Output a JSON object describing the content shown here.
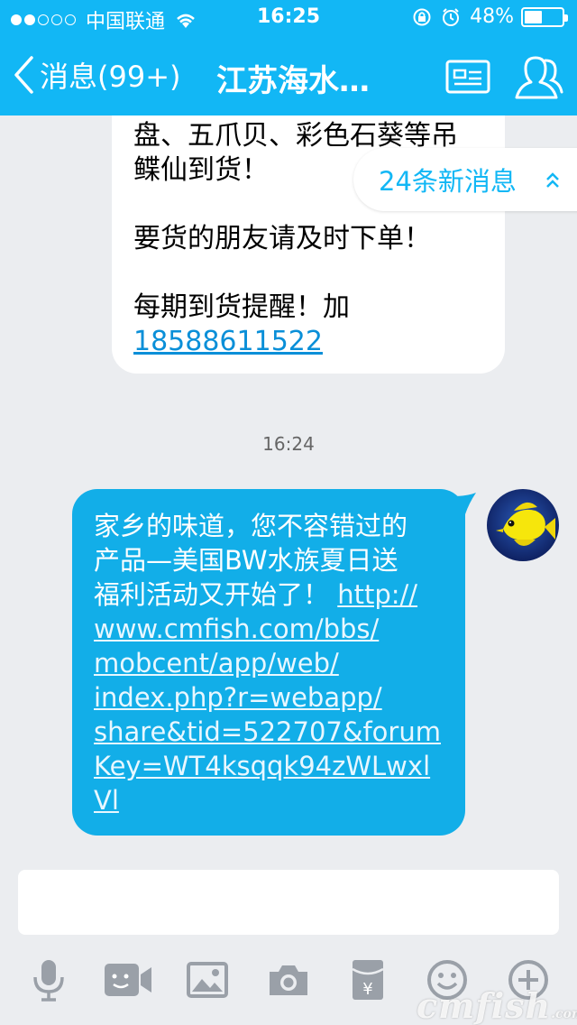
{
  "status_bar": {
    "carrier": "中国联通",
    "time": "16:25",
    "battery": "48%",
    "battery_level": 0.48,
    "signal_bars_filled": 2
  },
  "nav": {
    "back_label": "消息(99+)",
    "title": "江苏海水…"
  },
  "new_messages_badge": "24条新消息",
  "messages": {
    "received": {
      "lines": [
        "盘、五爪贝、彩色石葵等吊",
        "鲽仙到货！",
        "",
        "要货的朋友请及时下单！",
        "",
        "每期到货提醒！加"
      ],
      "phone": "18588611522"
    },
    "timestamp": "16:24",
    "sent": {
      "lines": [
        "家乡的味道，您不容错过的",
        "产品—美国BW水族夏日送"
      ],
      "line3_text": "福利活动又开始了！ ",
      "line3_link": "http://",
      "link_lines": [
        "www.cmfish.com/bbs/",
        "mobcent/app/web/",
        "index.php?r=webapp/",
        "share&tid=522707&forum",
        "Key=WT4ksqqk94zWLwxl",
        "Vl"
      ]
    }
  },
  "input": {
    "placeholder": ""
  },
  "toolbar_icons": [
    "microphone-icon",
    "video-icon",
    "image-icon",
    "camera-icon",
    "red-packet-icon",
    "emoji-icon",
    "plus-icon"
  ],
  "watermark": {
    "text": "cmfish",
    "suffix": ".com"
  },
  "colors": {
    "accent": "#12b7f5",
    "sent_bubble": "#12aee8",
    "background": "#ebedf0",
    "icon_gray": "#9aa0a8"
  }
}
